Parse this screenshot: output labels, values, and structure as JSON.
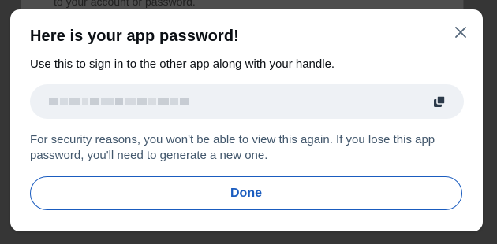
{
  "background": {
    "partial_text": "to your account or password."
  },
  "dialog": {
    "title": "Here is your app password!",
    "subtitle": "Use this to sign in to the other app along with your handle.",
    "password_masked": true,
    "copy_icon": "copy-icon",
    "close_icon": "close-icon",
    "notice": "For security reasons, you won't be able to view this again. If you lose this app password, you'll need to generate a new one.",
    "done_label": "Done"
  },
  "colors": {
    "accent": "#1a5cbf",
    "title": "#0b0f14",
    "muted_text": "#42576c",
    "field_bg": "#eef1f5"
  }
}
